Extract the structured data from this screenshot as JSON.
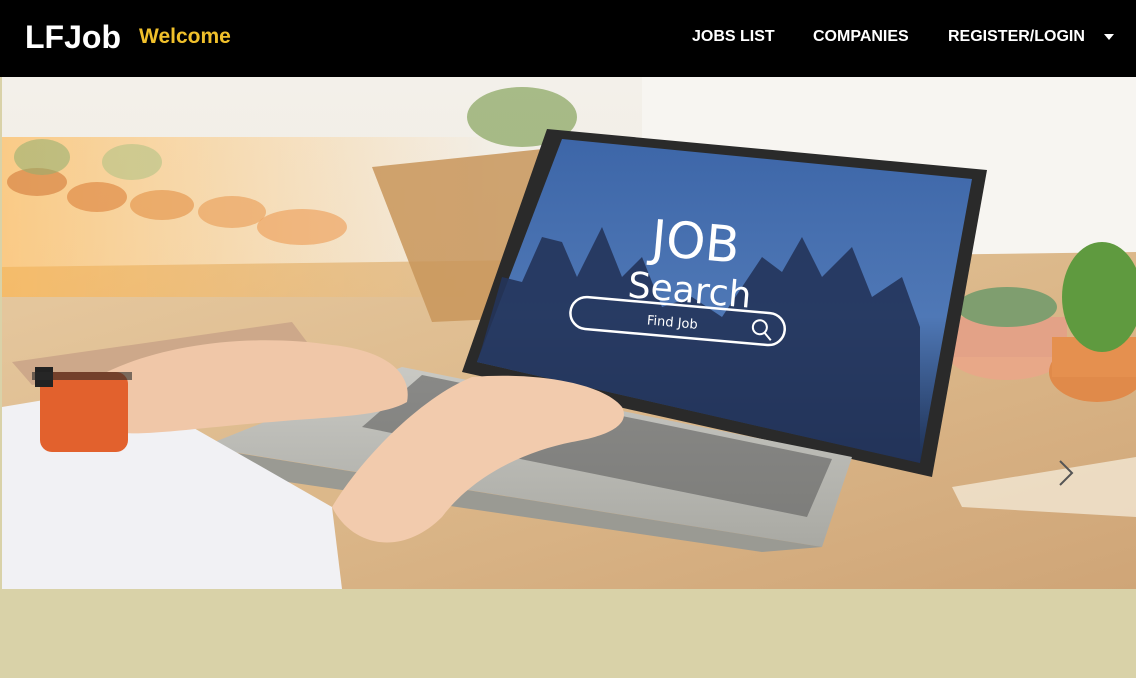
{
  "navbar": {
    "brand": "LFJob",
    "welcome": "Welcome",
    "links": [
      {
        "label": "JOBS LIST"
      },
      {
        "label": "COMPANIES"
      },
      {
        "label": "REGISTER/LOGIN"
      }
    ]
  },
  "hero": {
    "screen_line1": "JOB",
    "screen_line2": "Search",
    "search_placeholder": "Find Job"
  },
  "colors": {
    "navbar_bg": "#000000",
    "brand": "#ffffff",
    "welcome": "#f0c02b",
    "page_bg": "#d9d2a8"
  },
  "icons": [
    "chevron-down-icon",
    "chevron-right-icon",
    "search-icon"
  ]
}
